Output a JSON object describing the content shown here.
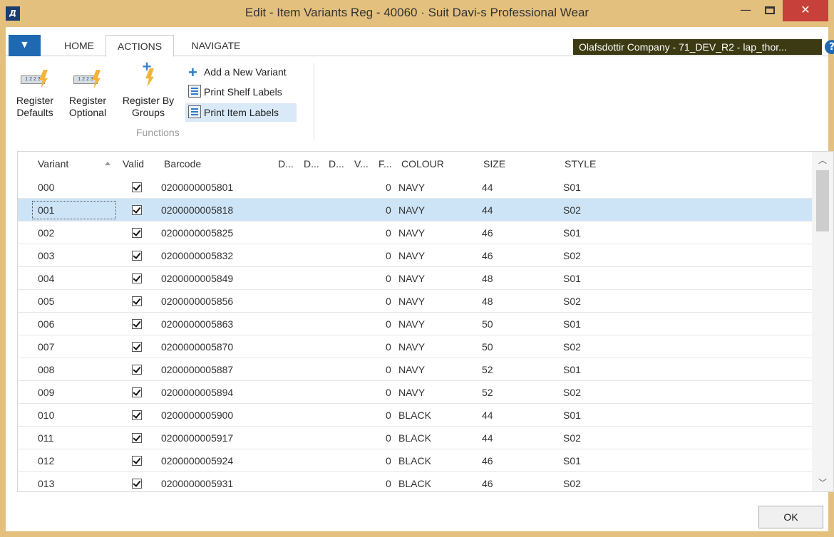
{
  "window": {
    "title": "Edit - Item Variants Reg - 40060 · Suit Davi-s Professional Wear",
    "logo_text": "Д",
    "min_label": "—",
    "close_label": "✕"
  },
  "ribbon_tabs": {
    "home": "HOME",
    "actions": "ACTIONS",
    "navigate": "NAVIGATE"
  },
  "company": "Olafsdottir Company - 71_DEV_R2 - lap_thor...",
  "help": "?",
  "actions": {
    "register_defaults": [
      "Register",
      "Defaults"
    ],
    "register_optional": [
      "Register",
      "Optional"
    ],
    "register_by_groups": [
      "Register By",
      "Groups"
    ],
    "add_new_variant": "Add a New Variant",
    "print_shelf_labels": "Print Shelf Labels",
    "print_item_labels": "Print Item Labels",
    "group_label": "Functions",
    "icon_panel_text": "1 2 2 3"
  },
  "grid": {
    "columns": {
      "variant": "Variant",
      "valid": "Valid",
      "barcode": "Barcode",
      "d1": "D...",
      "d2": "D...",
      "d3": "D...",
      "v": "V...",
      "f": "F...",
      "colour": "COLOUR",
      "size": "SIZE",
      "style": "STYLE"
    },
    "rows": [
      {
        "variant": "000",
        "valid": true,
        "barcode": "0200000005801",
        "f": "0",
        "colour": "NAVY",
        "size": "44",
        "style": "S01"
      },
      {
        "variant": "001",
        "valid": true,
        "barcode": "0200000005818",
        "f": "0",
        "colour": "NAVY",
        "size": "44",
        "style": "S02"
      },
      {
        "variant": "002",
        "valid": true,
        "barcode": "0200000005825",
        "f": "0",
        "colour": "NAVY",
        "size": "46",
        "style": "S01"
      },
      {
        "variant": "003",
        "valid": true,
        "barcode": "0200000005832",
        "f": "0",
        "colour": "NAVY",
        "size": "46",
        "style": "S02"
      },
      {
        "variant": "004",
        "valid": true,
        "barcode": "0200000005849",
        "f": "0",
        "colour": "NAVY",
        "size": "48",
        "style": "S01"
      },
      {
        "variant": "005",
        "valid": true,
        "barcode": "0200000005856",
        "f": "0",
        "colour": "NAVY",
        "size": "48",
        "style": "S02"
      },
      {
        "variant": "006",
        "valid": true,
        "barcode": "0200000005863",
        "f": "0",
        "colour": "NAVY",
        "size": "50",
        "style": "S01"
      },
      {
        "variant": "007",
        "valid": true,
        "barcode": "0200000005870",
        "f": "0",
        "colour": "NAVY",
        "size": "50",
        "style": "S02"
      },
      {
        "variant": "008",
        "valid": true,
        "barcode": "0200000005887",
        "f": "0",
        "colour": "NAVY",
        "size": "52",
        "style": "S01"
      },
      {
        "variant": "009",
        "valid": true,
        "barcode": "0200000005894",
        "f": "0",
        "colour": "NAVY",
        "size": "52",
        "style": "S02"
      },
      {
        "variant": "010",
        "valid": true,
        "barcode": "0200000005900",
        "f": "0",
        "colour": "BLACK",
        "size": "44",
        "style": "S01"
      },
      {
        "variant": "011",
        "valid": true,
        "barcode": "0200000005917",
        "f": "0",
        "colour": "BLACK",
        "size": "44",
        "style": "S02"
      },
      {
        "variant": "012",
        "valid": true,
        "barcode": "0200000005924",
        "f": "0",
        "colour": "BLACK",
        "size": "46",
        "style": "S01"
      },
      {
        "variant": "013",
        "valid": true,
        "barcode": "0200000005931",
        "f": "0",
        "colour": "BLACK",
        "size": "46",
        "style": "S02"
      }
    ],
    "selected_variant": "001"
  },
  "ok_label": "OK",
  "colors": {
    "frame": "#e4c07f",
    "selected_row": "#cde4f7",
    "accent": "#1f69b3",
    "close": "#c7403a"
  }
}
